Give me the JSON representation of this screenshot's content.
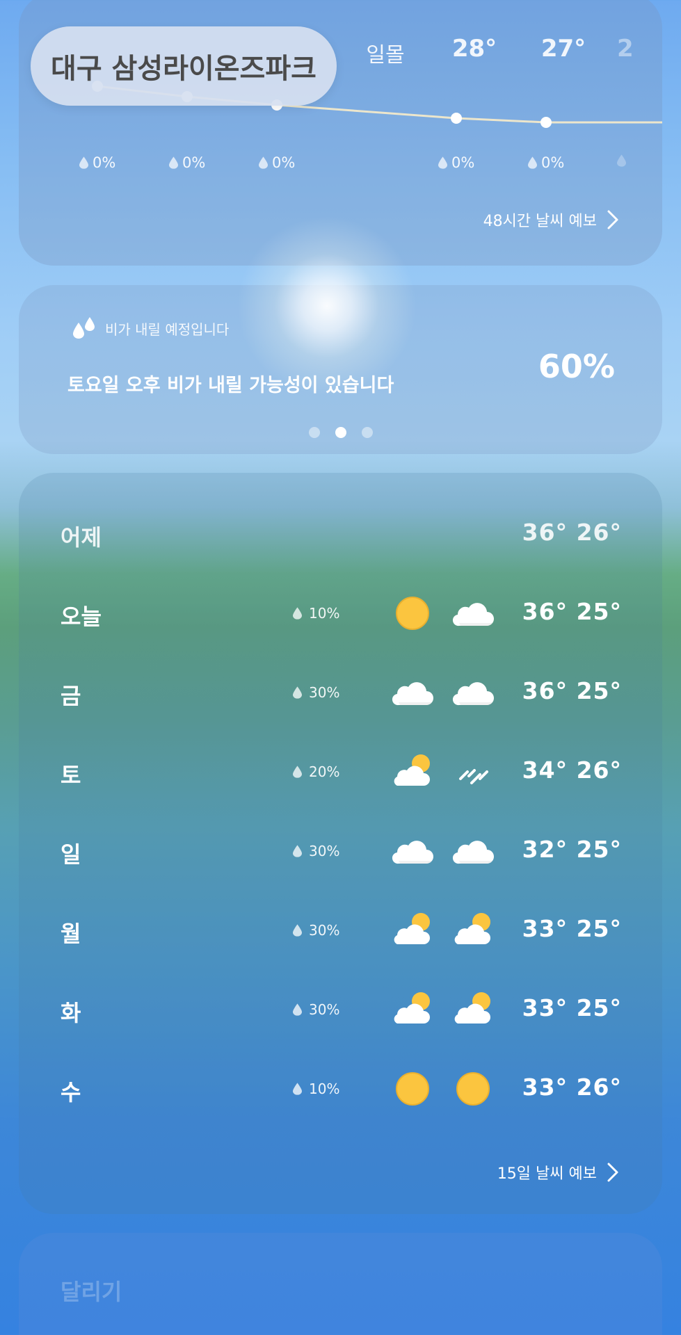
{
  "location": {
    "name": "대구 삼성라이온즈파크"
  },
  "hourly": {
    "labels": [
      {
        "text": "일몰",
        "kind": "sunset"
      },
      {
        "text": "28°",
        "kind": "temp"
      },
      {
        "text": "27°",
        "kind": "temp"
      },
      {
        "text": "2",
        "kind": "temp"
      }
    ],
    "precip": [
      "0%",
      "0%",
      "0%",
      "0%",
      "0%",
      ""
    ],
    "more_label": "48시간 날씨 예보"
  },
  "rain_alert": {
    "header": "비가 내릴 예정입니다",
    "message": "토요일 오후 비가 내릴 가능성이 있습니다",
    "percent": "60%",
    "page_count": 3,
    "active_page": 1
  },
  "daily": {
    "yesterday": {
      "label": "어제",
      "temps": "36° 26°"
    },
    "rows": [
      {
        "day": "오늘",
        "pop": "10%",
        "am_icon": "sun-icon",
        "pm_icon": "cloud-icon",
        "temps": "36° 25°"
      },
      {
        "day": "금",
        "pop": "30%",
        "am_icon": "cloud-icon",
        "pm_icon": "cloud-icon",
        "temps": "36° 25°"
      },
      {
        "day": "토",
        "pop": "20%",
        "am_icon": "partly-cloudy-icon",
        "pm_icon": "rain-icon",
        "temps": "34° 26°"
      },
      {
        "day": "일",
        "pop": "30%",
        "am_icon": "cloud-icon",
        "pm_icon": "cloud-icon",
        "temps": "32° 25°"
      },
      {
        "day": "월",
        "pop": "30%",
        "am_icon": "partly-cloudy-icon",
        "pm_icon": "partly-cloudy-icon",
        "temps": "33° 25°"
      },
      {
        "day": "화",
        "pop": "30%",
        "am_icon": "partly-cloudy-icon",
        "pm_icon": "partly-cloudy-icon",
        "temps": "33° 25°"
      },
      {
        "day": "수",
        "pop": "10%",
        "am_icon": "sun-icon",
        "pm_icon": "sun-icon",
        "temps": "33° 26°"
      }
    ],
    "more_label": "15일 날씨 예보"
  },
  "bottom_card": {
    "title": "달리기"
  },
  "colors": {
    "sun": "#fbc53f",
    "cloud": "#ffffff",
    "pill_text": "#4a4a4a"
  }
}
